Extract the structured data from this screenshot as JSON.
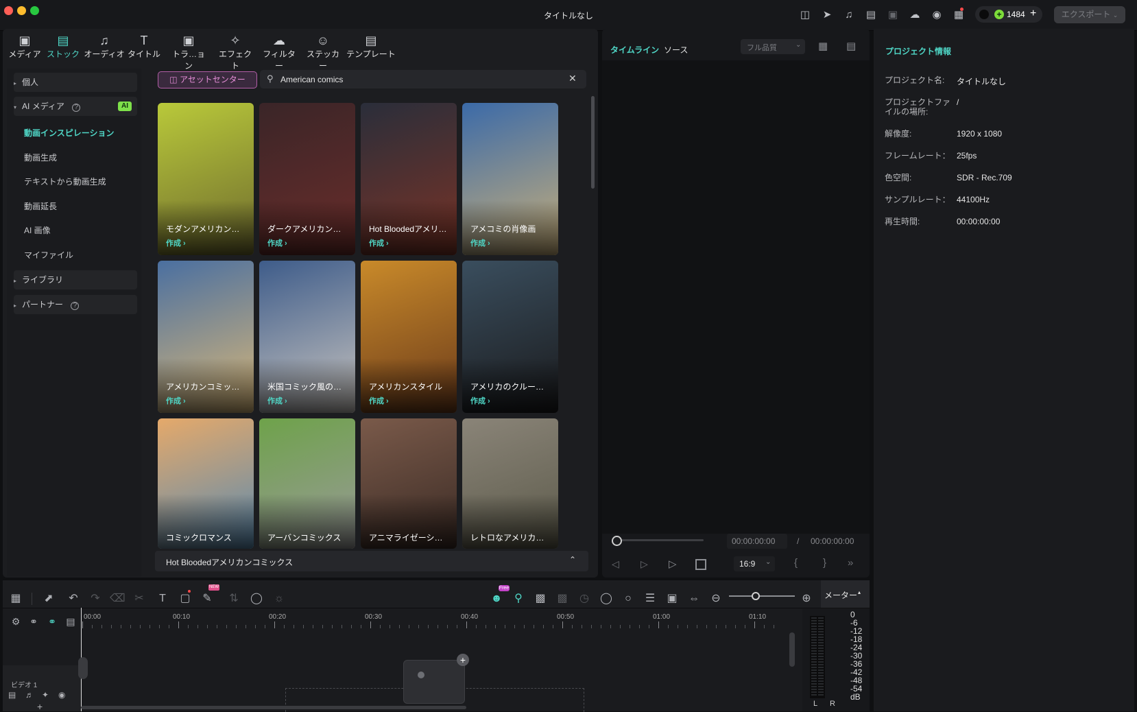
{
  "window": {
    "title": "タイトルなし",
    "credits": "1484",
    "export_label": "エクスポート"
  },
  "toolbar": {
    "tabs": [
      {
        "label": "メディア",
        "icon": "media-icon"
      },
      {
        "label": "ストック",
        "icon": "stock-icon"
      },
      {
        "label": "オーディオ",
        "icon": "audio-icon"
      },
      {
        "label": "タイトル",
        "icon": "title-icon"
      },
      {
        "label": "トラ…ョン",
        "icon": "transition-icon"
      },
      {
        "label": "エフェクト",
        "icon": "effect-icon"
      },
      {
        "label": "フィルター",
        "icon": "filter-icon"
      },
      {
        "label": "ステッカー",
        "icon": "sticker-icon"
      },
      {
        "label": "テンプレート",
        "icon": "template-icon"
      }
    ],
    "active_index": 1
  },
  "sidebar": {
    "personal": "個人",
    "ai_media": "AI メディア",
    "ai_badge": "AI",
    "items": [
      "動画インスピレーション",
      "動画生成",
      "テキストから動画生成",
      "動画延長",
      "AI 画像",
      "マイファイル"
    ],
    "active_item": 0,
    "library": "ライブラリ",
    "partner": "パートナー"
  },
  "stock": {
    "asset_center": "アセットセンター",
    "search_value": "American comics",
    "bottom_bar": "Hot Bloodedアメリカンコミックス",
    "create_label": "作成",
    "tiles": [
      {
        "label": "モダンアメリカンコ…",
        "create": true,
        "colors": [
          "#b9c93a",
          "#6e6a2e"
        ]
      },
      {
        "label": "ダークアメリカンコ…",
        "create": true,
        "colors": [
          "#3a2528",
          "#6b2d2a"
        ]
      },
      {
        "label": "Hot Bloodedアメリ…",
        "create": true,
        "colors": [
          "#2a2e3a",
          "#7a3326"
        ]
      },
      {
        "label": "アメコミの肖像画",
        "create": true,
        "colors": [
          "#3b6aa8",
          "#c9b07a"
        ]
      },
      {
        "label": "アメリカンコミック…",
        "create": true,
        "colors": [
          "#4a6fa0",
          "#d9b879"
        ]
      },
      {
        "label": "米国コミック風の肖…",
        "create": true,
        "colors": [
          "#3e5c8a",
          "#c9c5c0"
        ]
      },
      {
        "label": "アメリカンスタイル",
        "create": true,
        "colors": [
          "#c98a2a",
          "#6a3a1a"
        ]
      },
      {
        "label": "アメリカのクルーカ…",
        "create": true,
        "colors": [
          "#3a4e5e",
          "#1a1a1c"
        ]
      },
      {
        "label": "コミックロマンス",
        "create": false,
        "colors": [
          "#e5a96a",
          "#5a8ab0"
        ]
      },
      {
        "label": "アーバンコミックス",
        "create": false,
        "colors": [
          "#6ea24a",
          "#9a9a9a"
        ]
      },
      {
        "label": "アニマライゼーショ…",
        "create": false,
        "colors": [
          "#7a5a4a",
          "#3a2a24"
        ]
      },
      {
        "label": "レトロなアメリカン…",
        "create": false,
        "colors": [
          "#8a8478",
          "#5c5a4a"
        ]
      }
    ]
  },
  "preview": {
    "tab_timeline": "タイムライン",
    "tab_source": "ソース",
    "quality": "フル品質",
    "current_time": "00:00:00:00",
    "separator": "/",
    "total_time": "00:00:00:00",
    "aspect": "16:9"
  },
  "project": {
    "heading": "プロジェクト情報",
    "rows": [
      {
        "label": "プロジェクト名:",
        "value": "タイトルなし"
      },
      {
        "label": "プロジェクトファ\nイルの場所:",
        "value": "/"
      },
      {
        "label": "解像度:",
        "value": "1920 x 1080"
      },
      {
        "label": "フレームレート：",
        "value": "25fps"
      },
      {
        "label": "色空間:",
        "value": "SDR - Rec.709"
      },
      {
        "label": "サンプルレート：",
        "value": "44100Hz"
      },
      {
        "label": "再生時間:",
        "value": "00:00:00:00"
      }
    ]
  },
  "timeline": {
    "meter_label": "メーター",
    "ruler": [
      "00:00",
      "00:10",
      "00:20",
      "00:30",
      "00:40",
      "00:50",
      "01:00",
      "01:10"
    ],
    "db_scale": [
      "0",
      "-6",
      "-12",
      "-18",
      "-24",
      "-30",
      "-36",
      "-42",
      "-48",
      "-54",
      "dB"
    ],
    "channels": [
      "L",
      "R"
    ],
    "track_name": "ビデオ 1",
    "free_badge": "Free",
    "new_badge": "NEW"
  }
}
